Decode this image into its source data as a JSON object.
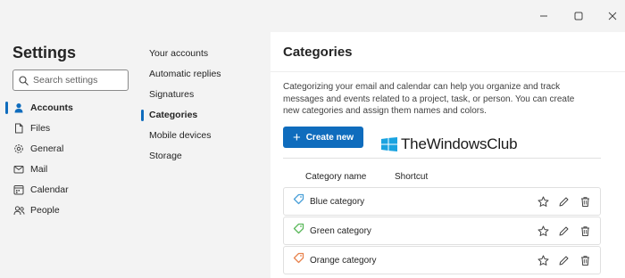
{
  "window": {
    "minimize_icon": "minimize-icon",
    "maximize_icon": "maximize-icon",
    "close_icon": "close-icon"
  },
  "left_nav": {
    "title": "Settings",
    "search_placeholder": "Search settings",
    "items": [
      {
        "label": "Accounts",
        "icon": "person-icon",
        "active": true
      },
      {
        "label": "Files",
        "icon": "file-icon",
        "active": false
      },
      {
        "label": "General",
        "icon": "gear-icon",
        "active": false
      },
      {
        "label": "Mail",
        "icon": "mail-icon",
        "active": false
      },
      {
        "label": "Calendar",
        "icon": "calendar-icon",
        "active": false
      },
      {
        "label": "People",
        "icon": "people-icon",
        "active": false
      }
    ]
  },
  "sub_nav": {
    "items": [
      {
        "label": "Your accounts",
        "active": false
      },
      {
        "label": "Automatic replies",
        "active": false
      },
      {
        "label": "Signatures",
        "active": false
      },
      {
        "label": "Categories",
        "active": true
      },
      {
        "label": "Mobile devices",
        "active": false
      },
      {
        "label": "Storage",
        "active": false
      }
    ]
  },
  "content": {
    "title": "Categories",
    "description": "Categorizing your email and calendar can help you organize and track messages and events related to a project, task, or person. You can create new categories and assign them names and colors.",
    "create_button": "Create new",
    "columns": {
      "name": "Category name",
      "shortcut": "Shortcut"
    },
    "categories": [
      {
        "label": "Blue category",
        "color": "#4aa0d8"
      },
      {
        "label": "Green category",
        "color": "#5bb85b"
      },
      {
        "label": "Orange category",
        "color": "#e8834e"
      }
    ]
  },
  "watermark": {
    "text": "TheWindowsClub"
  },
  "colors": {
    "accent": "#0f6cbd"
  }
}
